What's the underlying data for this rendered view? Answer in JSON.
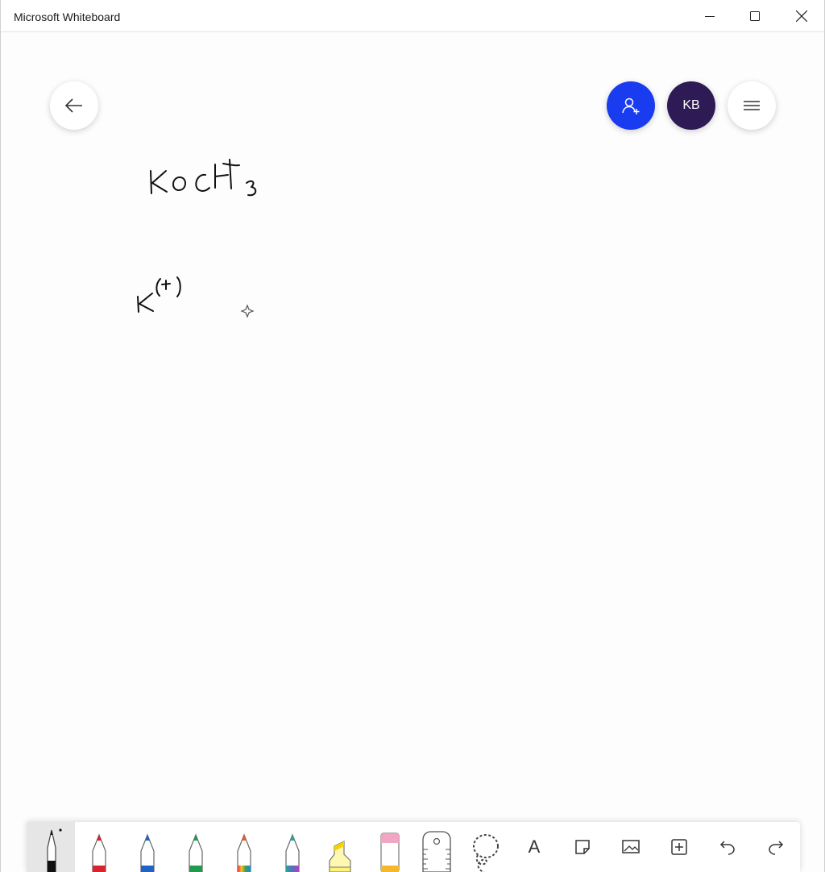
{
  "app": {
    "title": "Microsoft Whiteboard"
  },
  "avatar": {
    "initials": "KB"
  },
  "colors": {
    "invite_bg": "#1a3cf0",
    "avatar_bg": "#2e1a55",
    "pen_black": "#111111",
    "pen_red": "#d9232d",
    "pen_blue": "#1f63c9",
    "pen_green": "#1f9a4e",
    "highlighter_yellow": "#fff27a",
    "eraser_pink": "#f3a6c4"
  },
  "canvas_ink": {
    "line1": "KOCH3",
    "line2": "K(+)"
  },
  "toolbar": {
    "tools": [
      "black-pen",
      "red-pen",
      "blue-pen",
      "green-pen",
      "rainbow-pen",
      "galaxy-pen",
      "highlighter",
      "eraser",
      "ruler",
      "lasso",
      "text",
      "note",
      "image",
      "insert",
      "undo",
      "redo"
    ],
    "text_tool_label": "A"
  }
}
